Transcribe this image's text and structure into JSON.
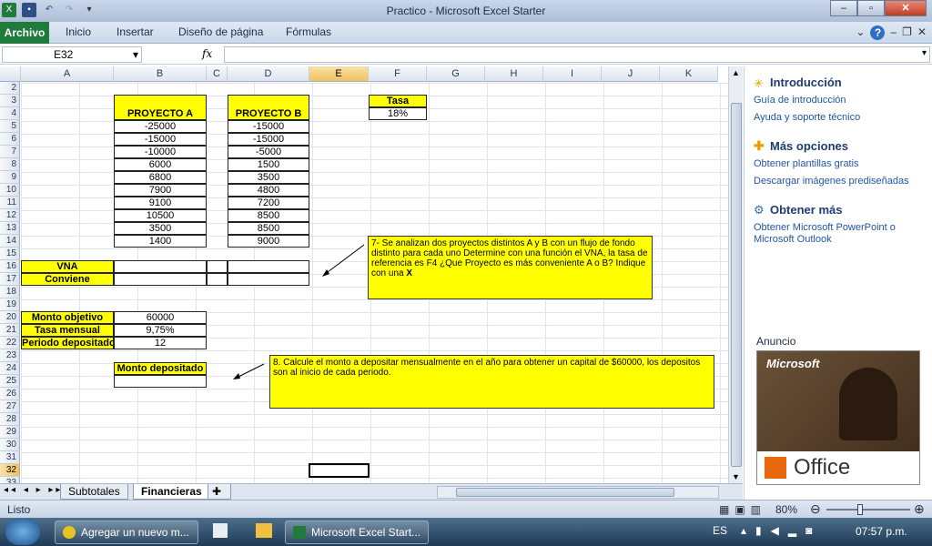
{
  "window": {
    "title": "Practico  -  Microsoft Excel Starter"
  },
  "ribbon": {
    "tabs": [
      "Archivo",
      "Inicio",
      "Insertar",
      "Diseño de página",
      "Fórmulas"
    ]
  },
  "formula_bar": {
    "name_box": "E32",
    "fx": "fx",
    "formula": ""
  },
  "columns": [
    "A",
    "B",
    "C",
    "D",
    "E",
    "F",
    "G",
    "H",
    "I",
    "J",
    "K"
  ],
  "selected_column": "E",
  "rows": [
    "2",
    "3",
    "4",
    "5",
    "6",
    "7",
    "8",
    "9",
    "10",
    "11",
    "12",
    "13",
    "14",
    "15",
    "16",
    "17",
    "18",
    "19",
    "20",
    "21",
    "22",
    "23",
    "24",
    "25",
    "26",
    "27",
    "28",
    "29",
    "30",
    "31",
    "32",
    "33"
  ],
  "selected_row": "32",
  "proyecto_a": {
    "header": "PROYECTO A",
    "values": [
      "-25000",
      "-15000",
      "-10000",
      "6000",
      "6800",
      "7900",
      "9100",
      "10500",
      "3500",
      "1400"
    ]
  },
  "proyecto_b": {
    "header": "PROYECTO B",
    "values": [
      "-15000",
      "-15000",
      "-5000",
      "1500",
      "3500",
      "4800",
      "7200",
      "8500",
      "8500",
      "9000"
    ]
  },
  "tasa": {
    "label": "Tasa",
    "value": "18%"
  },
  "vna": {
    "label": "VNA",
    "conviene": "Conviene"
  },
  "deposit": {
    "monto_label": "Monto objetivo",
    "monto_value": "60000",
    "tasa_label": "Tasa mensual",
    "tasa_value": "9,75%",
    "periodo_label": "Periodo depositado",
    "periodo_value": "12",
    "depositado_label": "Monto depositado"
  },
  "notes": {
    "note7_text": "7- Se analizan dos proyectos distintos A y B con un flujo de fondo distinto para cada uno Determine con una función el VNA, la tasa de referencia es F4 ¿Que Proyecto es más conveniente A o B? Indique con una ",
    "note7_bold": "X",
    "note8": "8. Calcule el monto a depositar mensualmente en el año para obtener un capital de $60000, los depositos son al inicio de cada periodo."
  },
  "sheet_tabs": [
    "Subtotales",
    "Financieras"
  ],
  "active_sheet": "Financieras",
  "status": {
    "mode": "Listo",
    "zoom": "80%"
  },
  "pane": {
    "h1": "Introducción",
    "l1": "Guía de introducción",
    "l2": "Ayuda y soporte técnico",
    "h2": "Más opciones",
    "l3": "Obtener plantillas gratis",
    "l4": "Descargar imágenes prediseñadas",
    "h3": "Obtener más",
    "l5": "Obtener Microsoft PowerPoint o Microsoft Outlook",
    "ad_label": "Anuncio",
    "ad_brand": "Microsoft",
    "ad_product": "Office"
  },
  "taskbar": {
    "items": [
      "Agregar un nuevo m...",
      "Microsoft Excel Start..."
    ],
    "lang": "ES",
    "time": "07:57 p.m."
  },
  "colors": {
    "highlight": "#ffff00",
    "accent": "#1f7a3c"
  }
}
